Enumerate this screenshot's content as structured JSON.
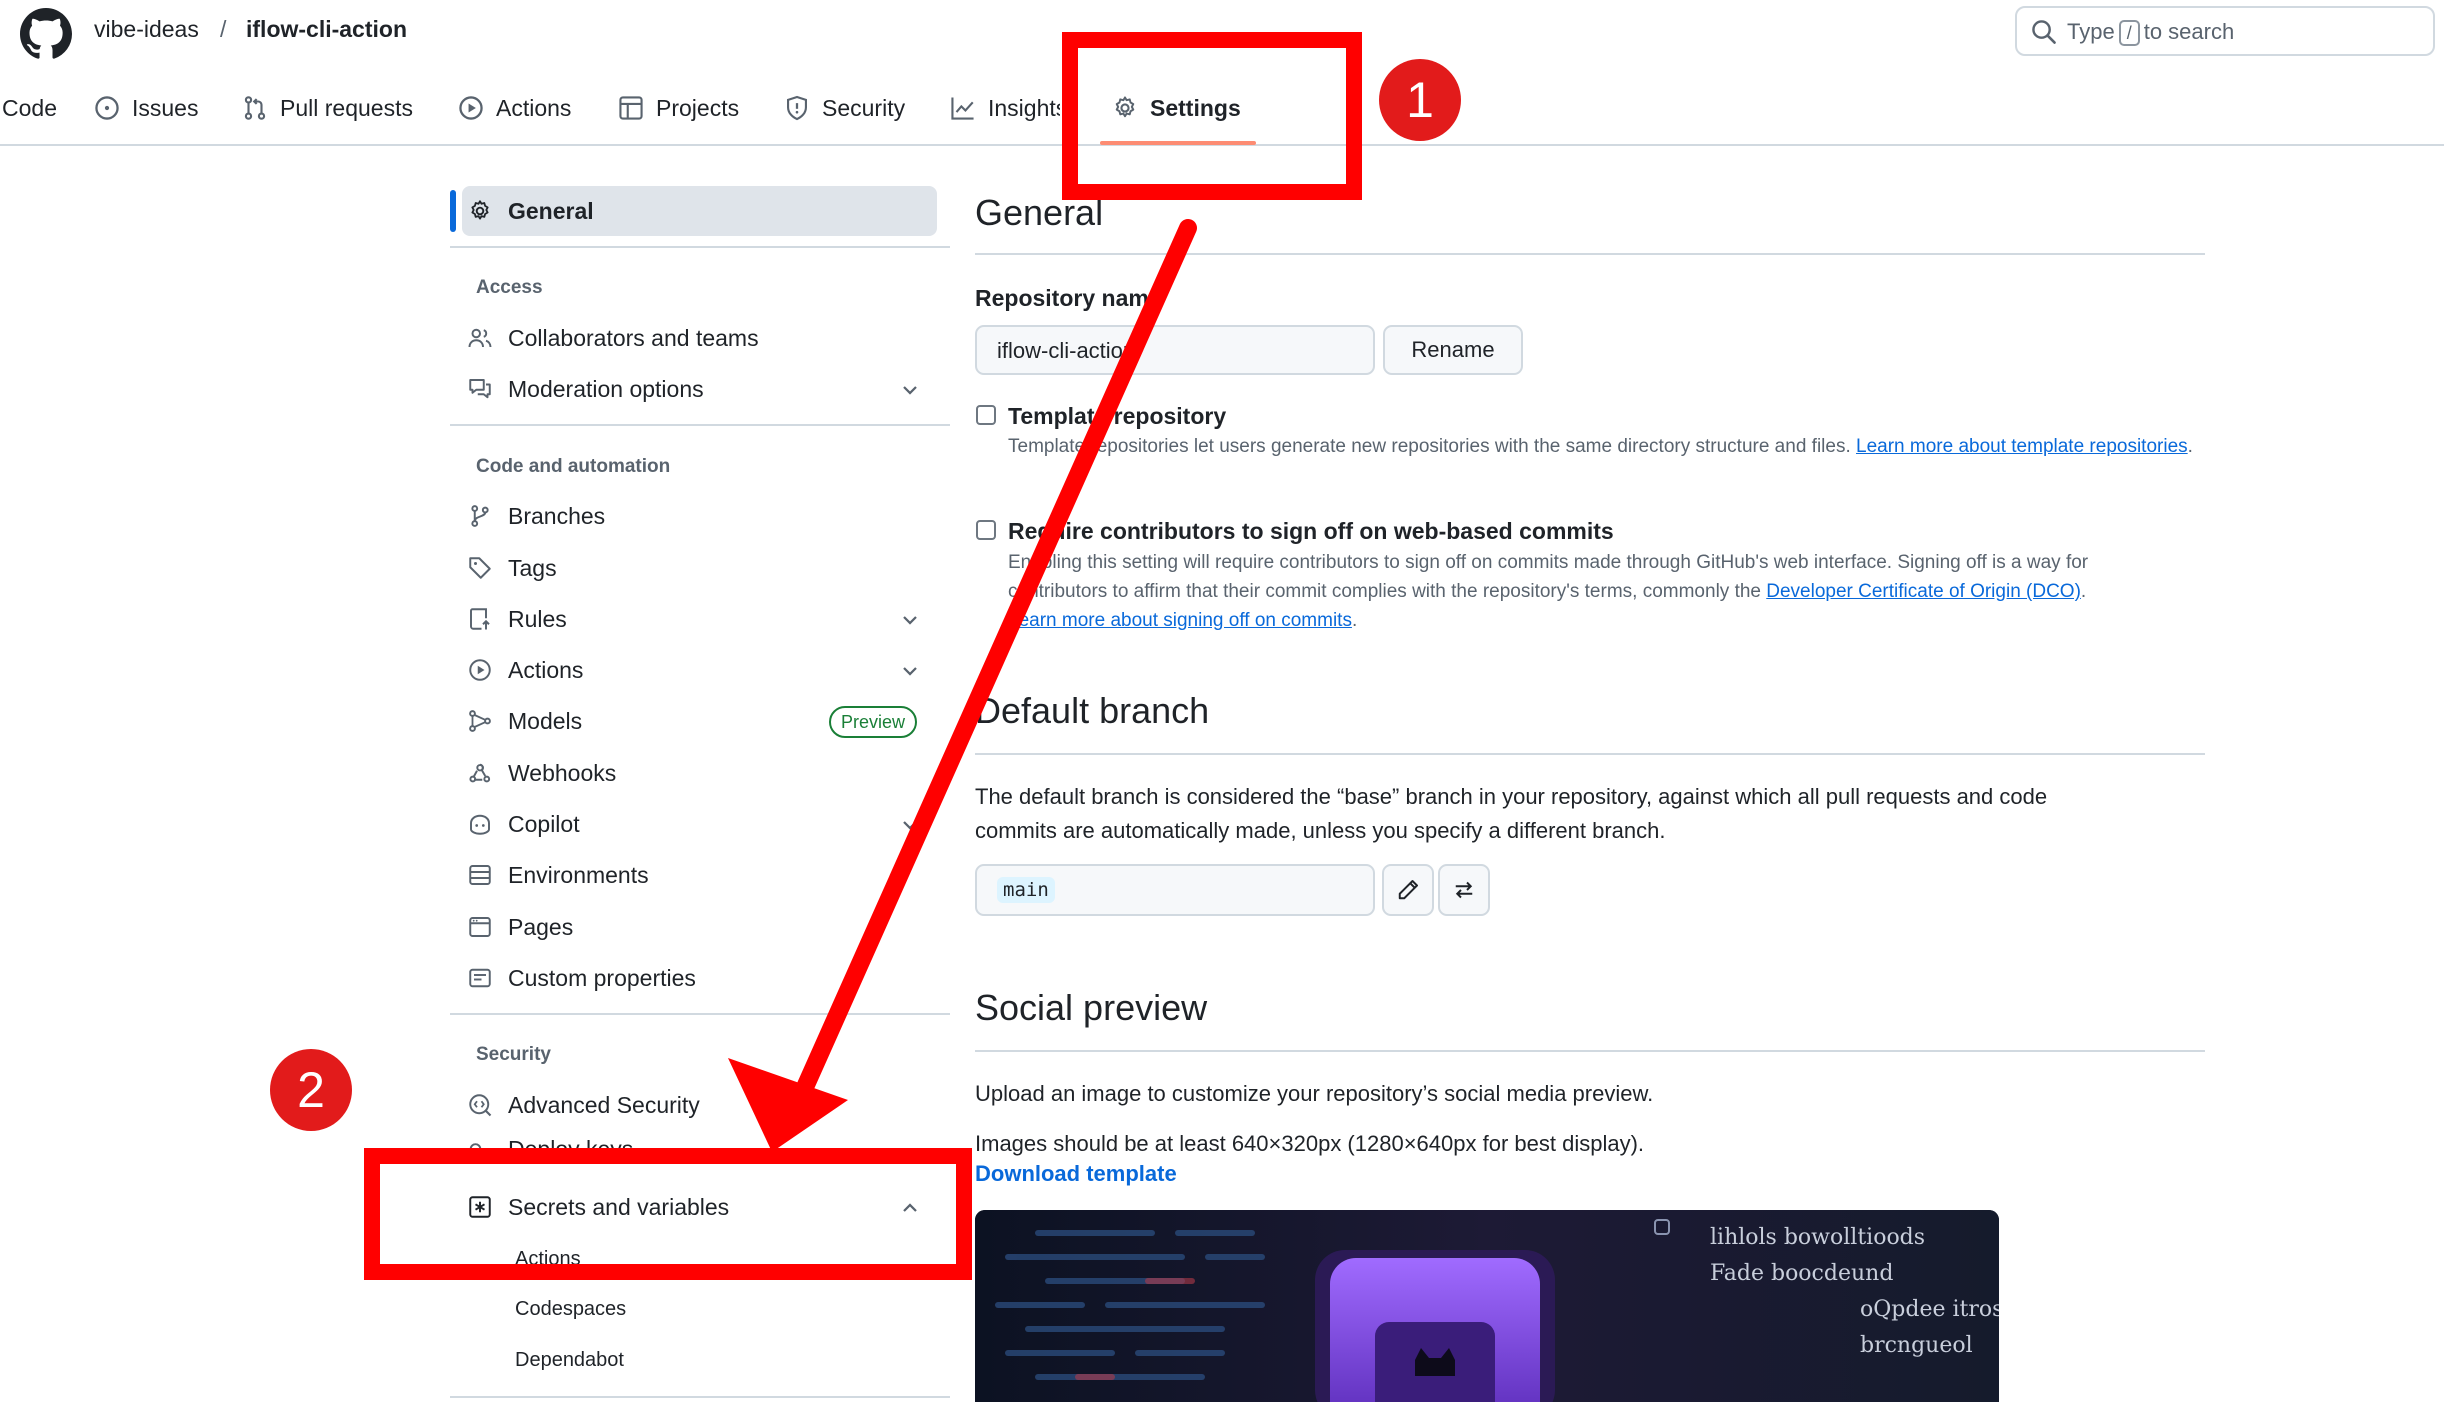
{
  "header": {
    "owner": "vibe-ideas",
    "separator": "/",
    "repo": "iflow-cli-action",
    "search": {
      "prefix": "Type",
      "key": "/",
      "suffix": "to search"
    }
  },
  "tabs": [
    {
      "label": "Code"
    },
    {
      "label": "Issues"
    },
    {
      "label": "Pull requests"
    },
    {
      "label": "Actions"
    },
    {
      "label": "Projects"
    },
    {
      "label": "Security"
    },
    {
      "label": "Insights"
    },
    {
      "label": "Settings"
    }
  ],
  "sidebar": {
    "general": "General",
    "access_heading": "Access",
    "access": [
      "Collaborators and teams",
      "Moderation options"
    ],
    "code_heading": "Code and automation",
    "code": [
      "Branches",
      "Tags",
      "Rules",
      "Actions",
      "Models",
      "Webhooks",
      "Copilot",
      "Environments",
      "Pages",
      "Custom properties"
    ],
    "preview_badge": "Preview",
    "security_heading": "Security",
    "security": [
      "Advanced Security",
      "Deploy keys",
      "Secrets and variables"
    ],
    "secrets_sub": [
      "Actions",
      "Codespaces",
      "Dependabot"
    ]
  },
  "general": {
    "title": "General",
    "repo_name_label": "Repository name",
    "repo_name_value": "iflow-cli-action",
    "rename_button": "Rename",
    "template_label": "Template repository",
    "template_desc": "Template repositories let users generate new repositories with the same directory structure and files.",
    "template_link": "Learn more about template repositories",
    "signoff_label": "Require contributors to sign off on web-based commits",
    "signoff_desc_1": "Enabling this setting will require contributors to sign off on commits made through GitHub's web interface. Signing off is a way for",
    "signoff_desc_2": "contributors to affirm that their commit complies with the repository's terms, commonly the",
    "signoff_dco_link": "Developer Certificate of Origin (DCO)",
    "signoff_link": "Learn more about signing off on commits"
  },
  "default_branch": {
    "title": "Default branch",
    "desc_1": "The default branch is considered the “base” branch in your repository, against which all pull requests and code",
    "desc_2": "commits are automatically made, unless you specify a different branch.",
    "branch": "main"
  },
  "social_preview": {
    "title": "Social preview",
    "desc": "Upload an image to customize your repository’s social media preview.",
    "size_note": "Images should be at least 640×320px (1280×640px for best display).",
    "download_link": "Download template",
    "image_text": [
      "lihlols bowolltioods",
      "Fade boocdeund",
      "oQpdee itros",
      "brcngueol"
    ]
  },
  "annotations": {
    "step1": "1",
    "step2": "2"
  },
  "colors": {
    "annotation_red": "#ff0000",
    "accent_blue": "#0969da",
    "preview_green": "#1a7f37",
    "tab_underline": "#fd8c73"
  }
}
